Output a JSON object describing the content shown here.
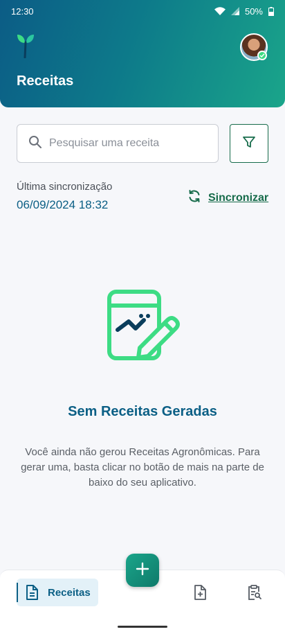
{
  "status_bar": {
    "time": "12:30",
    "battery": "50%"
  },
  "header": {
    "title": "Receitas"
  },
  "search": {
    "placeholder": "Pesquisar uma receita"
  },
  "sync": {
    "label": "Última sincronização",
    "date": "06/09/2024 18:32",
    "button_label": "Sincronizar"
  },
  "empty_state": {
    "title": "Sem Receitas Geradas",
    "message": "Você ainda não gerou Receitas Agronômicas. Para gerar uma, basta clicar no botão de mais na parte de baixo do seu aplicativo."
  },
  "bottom_nav": {
    "items": [
      {
        "label": "Receitas",
        "icon": "document-icon",
        "active": true
      },
      {
        "label": "",
        "icon": "document-add-icon",
        "active": false
      },
      {
        "label": "",
        "icon": "clipboard-search-icon",
        "active": false
      }
    ]
  },
  "colors": {
    "primary": "#0b5f85",
    "accent_green": "#166b4a",
    "illustration_green": "#3ddc84",
    "header_gradient_start": "#0c5c86",
    "header_gradient_end": "#1aa58a"
  }
}
